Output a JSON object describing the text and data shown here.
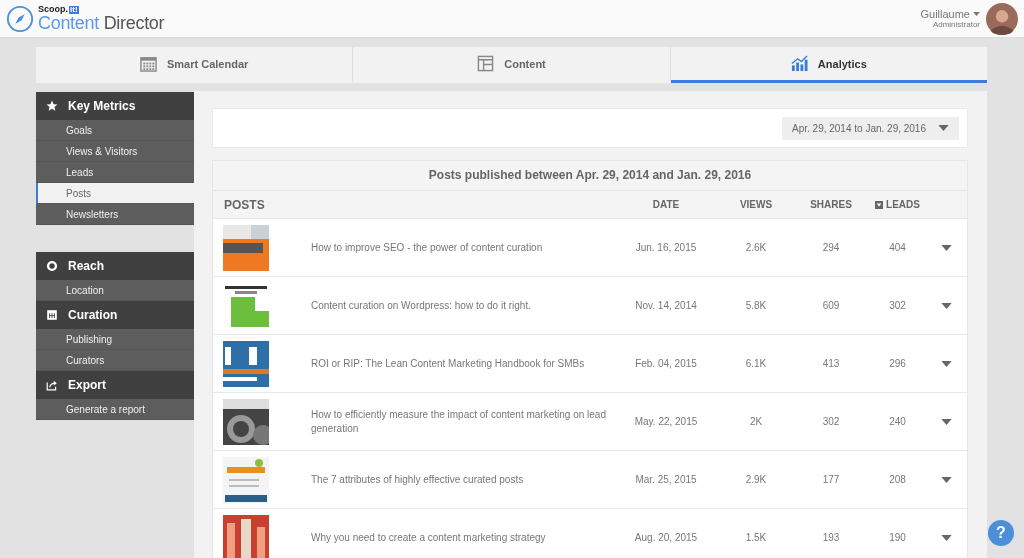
{
  "header": {
    "logo_small": "Scoop.",
    "logo_badge": "it!",
    "logo_main": "Content",
    "logo_rest": " Director",
    "user_name": "Guillaume",
    "user_role": "Administrator"
  },
  "tabs": [
    {
      "label": "Smart Calendar",
      "selected": false
    },
    {
      "label": "Content",
      "selected": false
    },
    {
      "label": "Analytics",
      "selected": true
    }
  ],
  "sidebar": {
    "groups": [
      {
        "title": "Key Metrics",
        "items": [
          {
            "label": "Goals",
            "selected": false
          },
          {
            "label": "Views & Visitors",
            "selected": false
          },
          {
            "label": "Leads",
            "selected": false
          },
          {
            "label": "Posts",
            "selected": true
          },
          {
            "label": "Newsletters",
            "selected": false
          }
        ]
      },
      {
        "title": "Reach",
        "items": [
          {
            "label": "Location",
            "selected": false
          }
        ]
      },
      {
        "title": "Curation",
        "items": [
          {
            "label": "Publishing",
            "selected": false
          },
          {
            "label": "Curators",
            "selected": false
          }
        ]
      },
      {
        "title": "Export",
        "items": [
          {
            "label": "Generate a report",
            "selected": false
          }
        ]
      }
    ]
  },
  "date_range": "Apr. 29, 2014 to Jan. 29, 2016",
  "table": {
    "title": "Posts published between Apr. 29, 2014 and Jan. 29, 2016",
    "columns": [
      {
        "label": "POSTS",
        "sorted": false
      },
      {
        "label": "DATE",
        "sorted": false
      },
      {
        "label": "VIEWS",
        "sorted": false
      },
      {
        "label": "SHARES",
        "sorted": false
      },
      {
        "label": "LEADS",
        "sorted": true
      }
    ],
    "rows": [
      {
        "title": "How to improve SEO - the power of content curation",
        "date": "Jun. 16, 2015",
        "views": "2.6K",
        "shares": "294",
        "leads": "404"
      },
      {
        "title": "Content curation on Wordpress: how to do it right.",
        "date": "Nov. 14, 2014",
        "views": "5.8K",
        "shares": "609",
        "leads": "302"
      },
      {
        "title": "ROI or RIP: The Lean Content Marketing Handbook for SMBs",
        "date": "Feb. 04, 2015",
        "views": "6.1K",
        "shares": "413",
        "leads": "296"
      },
      {
        "title": "How to efficiently measure the impact of content marketing on lead generation",
        "date": "May. 22, 2015",
        "views": "2K",
        "shares": "302",
        "leads": "240"
      },
      {
        "title": "The 7 attributes of highly effective curated posts",
        "date": "Mar. 25, 2015",
        "views": "2.9K",
        "shares": "177",
        "leads": "208"
      },
      {
        "title": "Why you need to create a content marketing strategy",
        "date": "Aug. 20, 2015",
        "views": "1.5K",
        "shares": "193",
        "leads": "190"
      }
    ]
  },
  "help_button": "?"
}
